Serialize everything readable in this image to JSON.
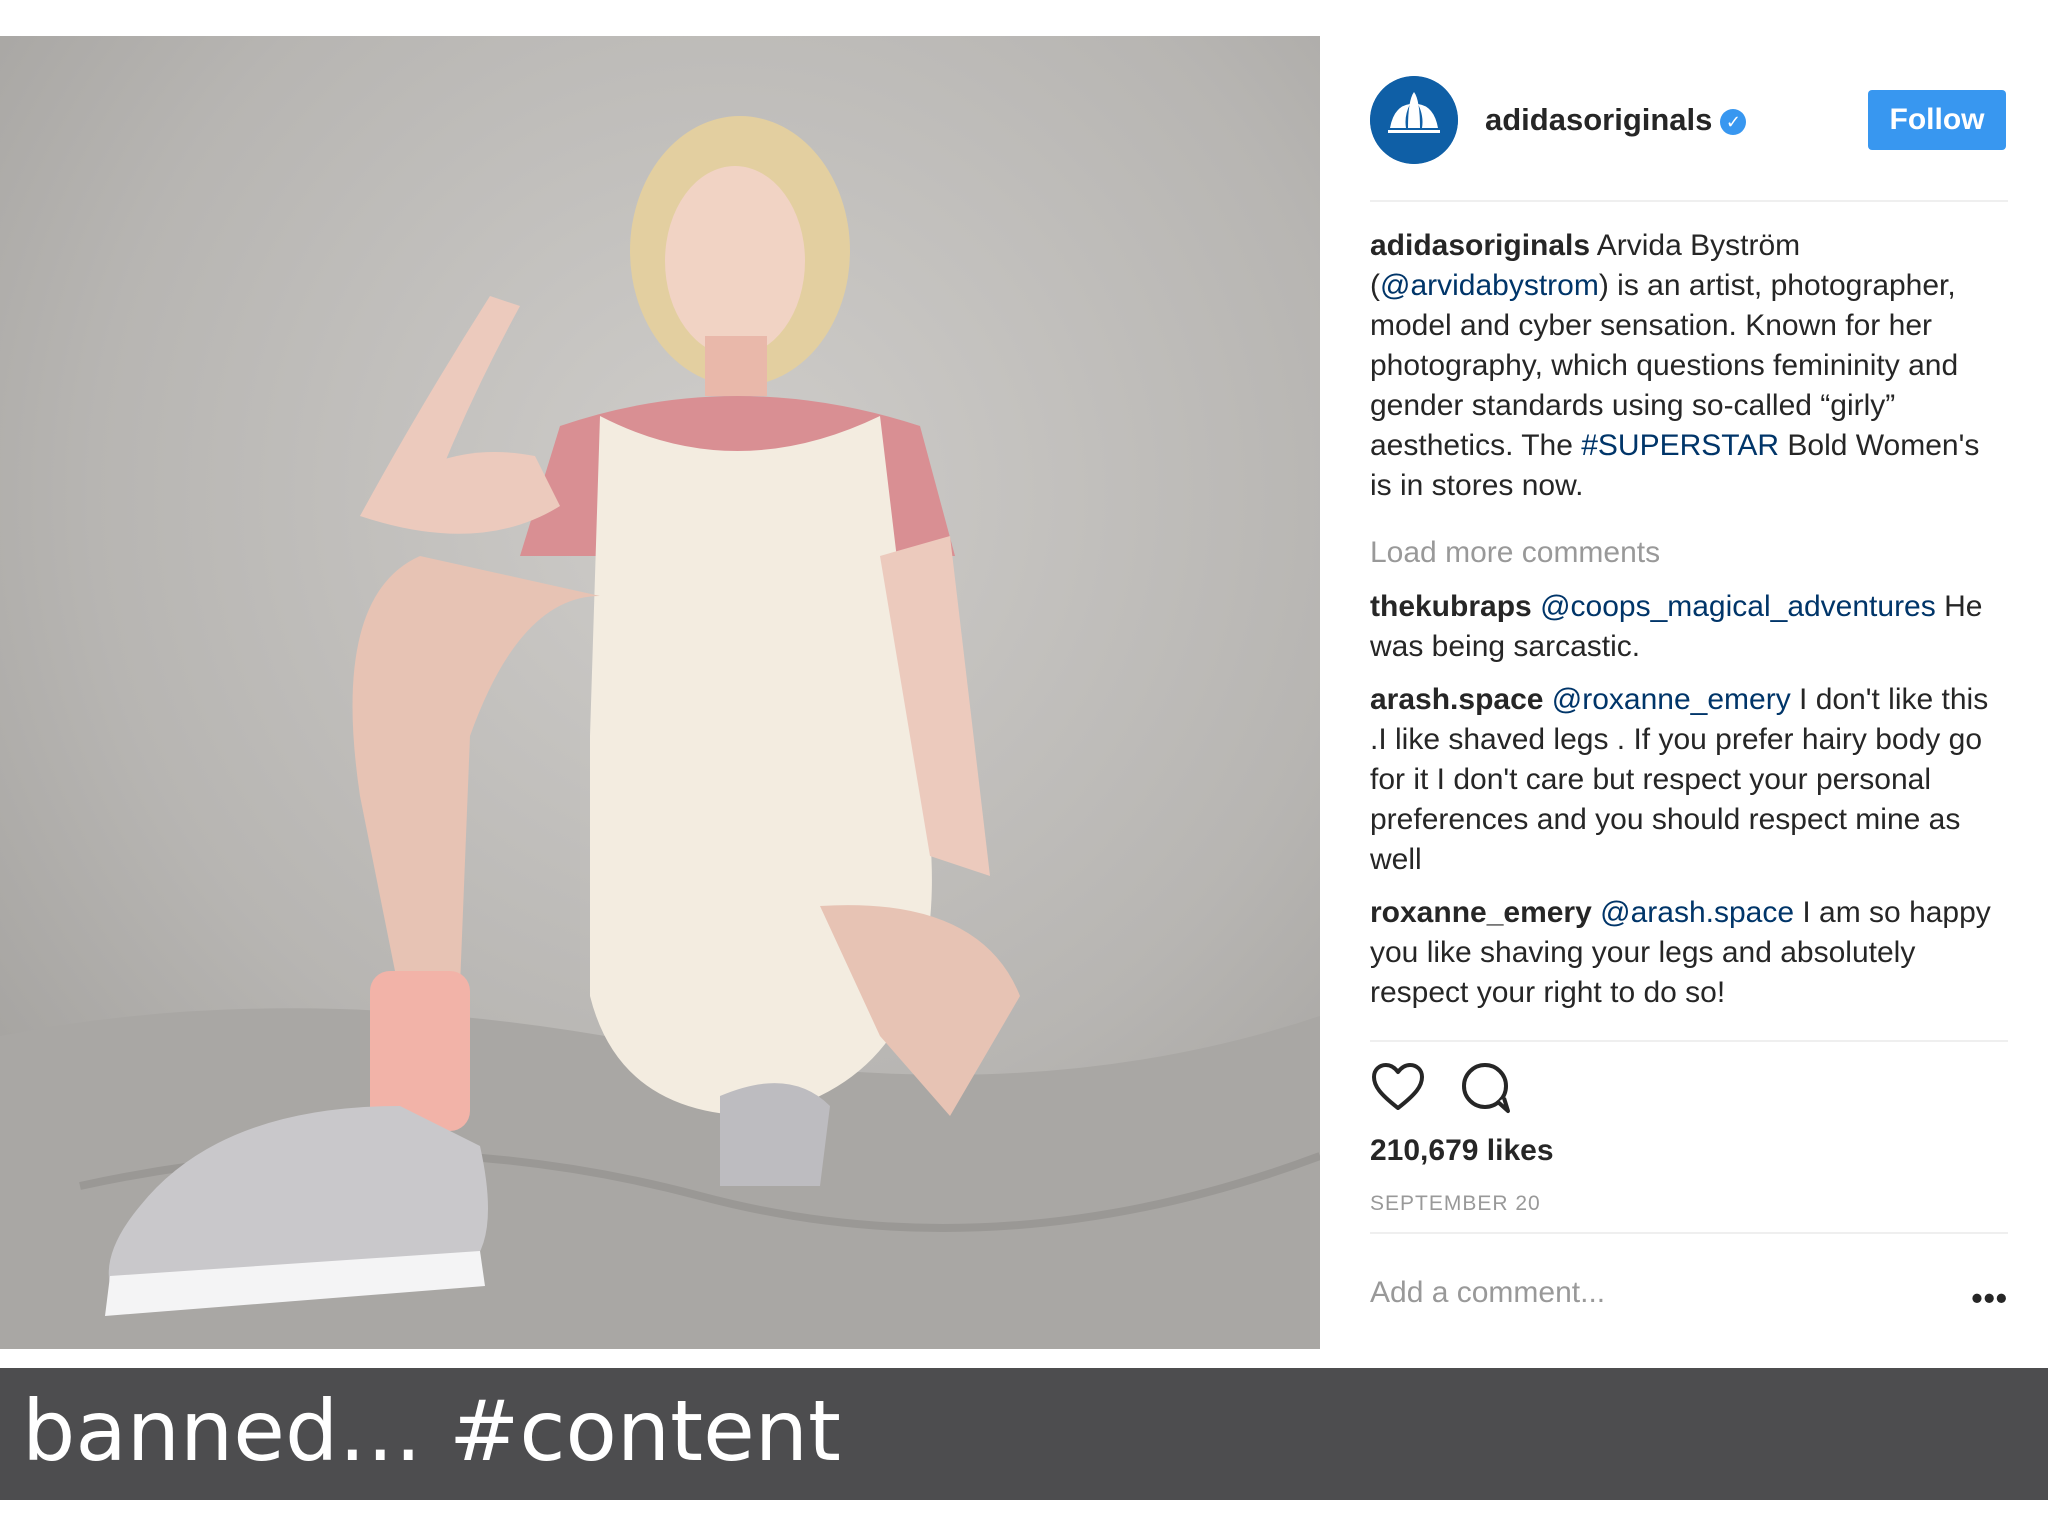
{
  "post": {
    "username": "adidasoriginals",
    "avatar_text": "adidas",
    "follow_label": "Follow",
    "caption": {
      "user": "adidasoriginals",
      "text_1": " Arvida Byström (",
      "mention": "@arvidabystrom",
      "text_2": ") is an artist, photographer, model and cyber sensation. Known for her photography, which questions femininity and gender standards using so-called “girly” aesthetics. The ",
      "hashtag": "#SUPERSTAR",
      "text_3": " Bold Women's is in stores now."
    },
    "load_more": "Load more comments",
    "comments": [
      {
        "user": "thekubraps",
        "mention": "@coops_magical_adventures",
        "text": " He was being sarcastic."
      },
      {
        "user": "arash.space",
        "mention": "@roxanne_emery",
        "text": " I don't like this .I like shaved legs . If you prefer hairy body go for it I don't care but respect your personal preferences and you should respect mine as well"
      },
      {
        "user": "roxanne_emery",
        "mention": "@arash.space",
        "text": " I am so happy you like shaving your legs and absolutely respect your right to do so!"
      }
    ],
    "likes": "210,679 likes",
    "date": "SEPTEMBER 20",
    "add_comment_placeholder": "Add a comment...",
    "more_label": "•••"
  },
  "slide_caption": "banned… #content",
  "icons": [
    "heart-icon",
    "comment-icon",
    "verified-badge-icon",
    "adidas-trefoil-logo"
  ],
  "colors": {
    "follow_button": "#3897f0",
    "mention": "#003569",
    "muted": "#999999",
    "caption_bar": "#4d4d4f",
    "avatar": "#0f5fa6"
  }
}
